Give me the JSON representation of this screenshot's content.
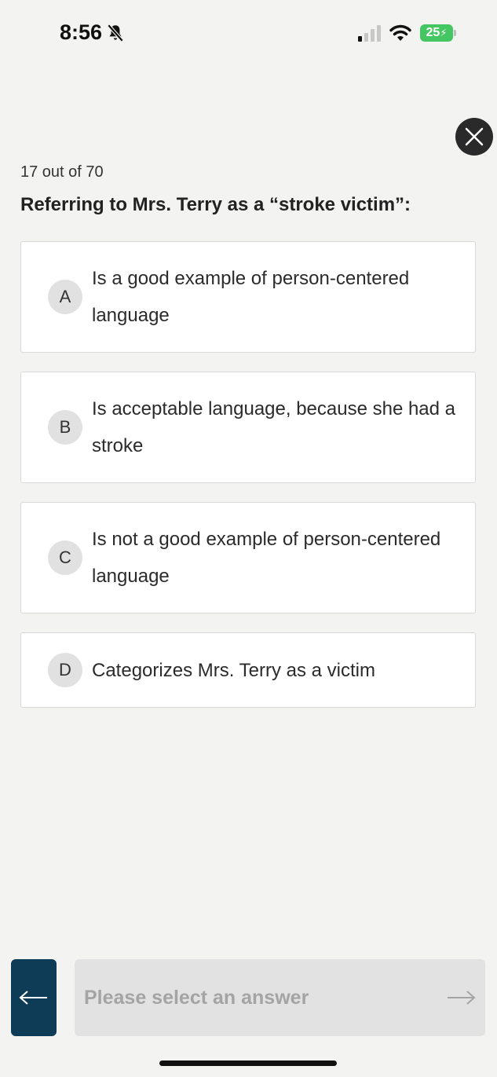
{
  "status_bar": {
    "time": "8:56",
    "battery": "25"
  },
  "quiz": {
    "counter": "17 out of 70",
    "question": "Referring to Mrs. Terry as a “stroke victim”:",
    "options": [
      {
        "letter": "A",
        "text": "Is a good example of person-centered language"
      },
      {
        "letter": "B",
        "text": "Is acceptable language, because she had a stroke"
      },
      {
        "letter": "C",
        "text": "Is not a good example of person-centered language"
      },
      {
        "letter": "D",
        "text": "Categorizes Mrs. Terry as a victim"
      }
    ]
  },
  "footer": {
    "next_label": "Please select an answer"
  },
  "colors": {
    "background": "#f3f3f2",
    "back_button": "#0e3b56",
    "next_button_disabled": "#e2e2e2"
  },
  "icons": {
    "close": "close-icon",
    "back": "arrow-left-icon",
    "next": "arrow-right-icon",
    "bell": "bell-slash-icon",
    "wifi": "wifi-icon",
    "signal": "cellular-signal-icon",
    "battery": "battery-charging-icon"
  }
}
